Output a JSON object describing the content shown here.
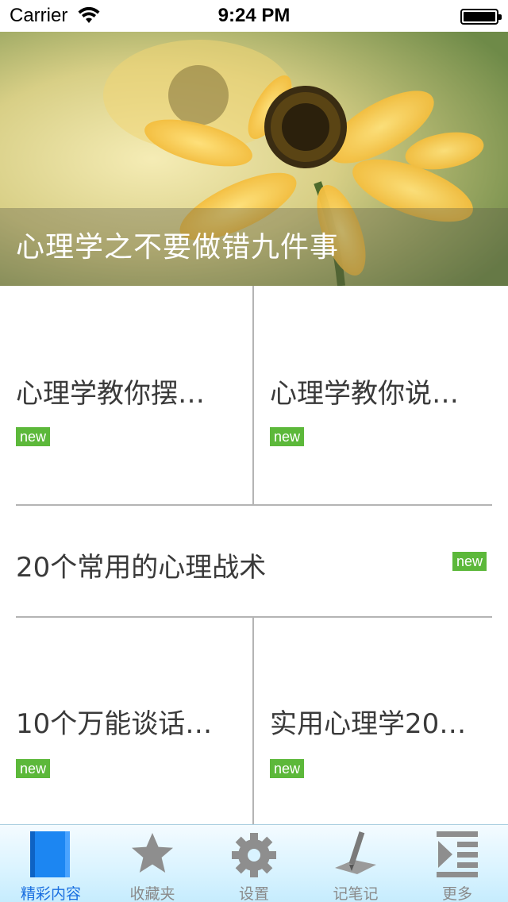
{
  "status_bar": {
    "carrier": "Carrier",
    "time": "9:24 PM"
  },
  "hero": {
    "title": "心理学之不要做错九件事"
  },
  "articles": [
    {
      "title": "心理学教你摆…",
      "badge": "new"
    },
    {
      "title": "心理学教你说…",
      "badge": "new"
    },
    {
      "title": "20个常用的心理战术",
      "badge": "new"
    },
    {
      "title": "10个万能谈话…",
      "badge": "new"
    },
    {
      "title": "实用心理学20…",
      "badge": "new"
    }
  ],
  "tabs": [
    {
      "label": "精彩内容",
      "icon": "book-icon",
      "active": true
    },
    {
      "label": "收藏夹",
      "icon": "star-icon",
      "active": false
    },
    {
      "label": "设置",
      "icon": "gear-icon",
      "active": false
    },
    {
      "label": "记笔记",
      "icon": "pen-icon",
      "active": false
    },
    {
      "label": "更多",
      "icon": "more-list-icon",
      "active": false
    }
  ],
  "colors": {
    "badge": "#5cb83a",
    "active_tab": "#1a6fe0",
    "inactive_tab": "#8a8a8a",
    "divider": "#b4b4b4"
  }
}
